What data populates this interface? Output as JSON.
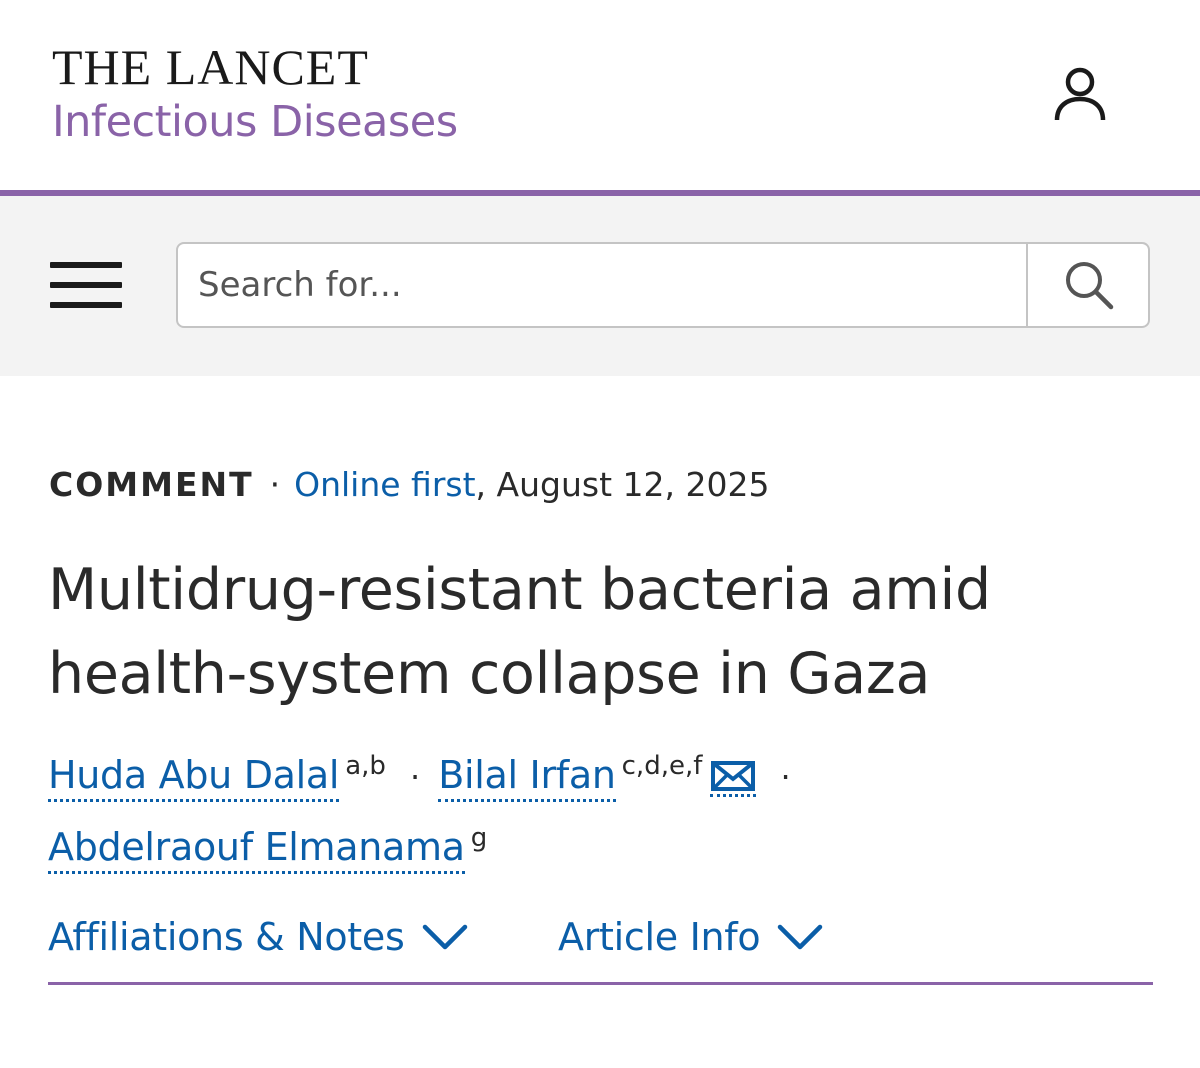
{
  "header": {
    "logo_line1": "THE LANCET",
    "logo_line2": "Infectious Diseases",
    "user_icon": "user-icon"
  },
  "search": {
    "placeholder": "Search for...",
    "menu_icon": "hamburger-menu-icon",
    "search_icon": "search-icon"
  },
  "article": {
    "type": "COMMENT",
    "separator": "·",
    "status": "Online first",
    "date": ", August 12, 2025",
    "title": "Multidrug-resistant bacteria amid health-system collapse in Gaza",
    "authors": [
      {
        "name": "Huda Abu Dalal",
        "affiliations": "a,b"
      },
      {
        "name": "Bilal Irfan",
        "affiliations": "c,d,e,f",
        "email_icon": "envelope-icon"
      },
      {
        "name": "Abdelraouf Elmanama",
        "affiliations": "g"
      }
    ],
    "author_separator": "·",
    "sections": [
      {
        "label": "Affiliations & Notes"
      },
      {
        "label": "Article Info"
      }
    ]
  },
  "colors": {
    "brand_purple": "#8a63a8",
    "link_blue": "#0b5ea8",
    "text": "#2a2a2a",
    "search_band": "#f3f3f3"
  }
}
